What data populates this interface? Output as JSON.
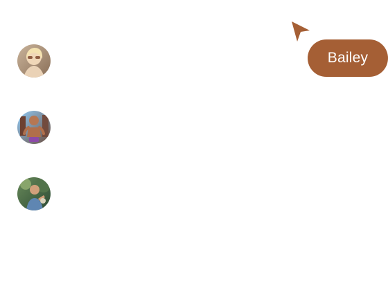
{
  "avatars": [
    {
      "name": "avatar-1",
      "icon": "user-photo"
    },
    {
      "name": "avatar-2",
      "icon": "user-photo"
    },
    {
      "name": "avatar-3",
      "icon": "user-photo"
    }
  ],
  "cursor": {
    "label": "Bailey",
    "color": "#a55f35",
    "icon": "pointer-arrow-icon"
  }
}
